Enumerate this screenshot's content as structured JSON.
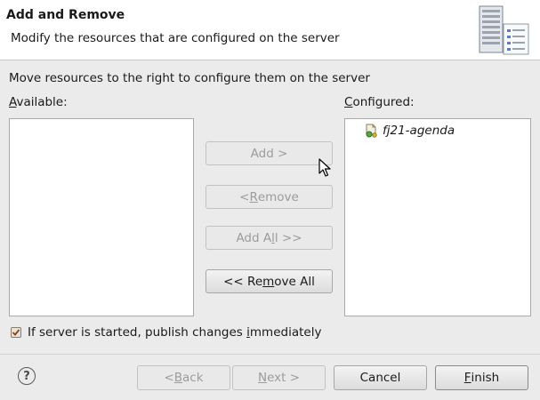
{
  "header": {
    "title": "Add and Remove",
    "description": "Modify the resources that are configured on the server",
    "icon": "server-wizard-icon"
  },
  "instruction": "Move resources to the right to configure them on the server",
  "available": {
    "label_mnemonic": "A",
    "label_rest": "vailable:",
    "items": []
  },
  "configured": {
    "label_mnemonic": "C",
    "label_rest": "onfigured:",
    "items": [
      {
        "label": "fj21-agenda",
        "icon": "web-module-icon"
      }
    ]
  },
  "buttons": {
    "add": {
      "pre": "Add >",
      "mn": "",
      "post": ""
    },
    "remove": {
      "pre": "< ",
      "mn": "R",
      "post": "emove"
    },
    "add_all": {
      "pre": "Add A",
      "mn": "l",
      "post": "l >>"
    },
    "remove_all": {
      "pre": "<< Re",
      "mn": "m",
      "post": "ove All"
    }
  },
  "checkbox": {
    "checked": true,
    "pre": "If server is started, publish changes ",
    "mn": "i",
    "post": "mmediately"
  },
  "footer": {
    "back": {
      "pre": "< ",
      "mn": "B",
      "post": "ack"
    },
    "next": {
      "pre": "",
      "mn": "N",
      "post": "ext >"
    },
    "cancel": "Cancel",
    "finish": {
      "pre": "",
      "mn": "F",
      "post": "inish"
    },
    "help_glyph": "?"
  },
  "colors": {
    "checkbox_mark": "#8b4513",
    "dialog_bg": "#ebebeb",
    "header_bg": "#ffffff"
  }
}
